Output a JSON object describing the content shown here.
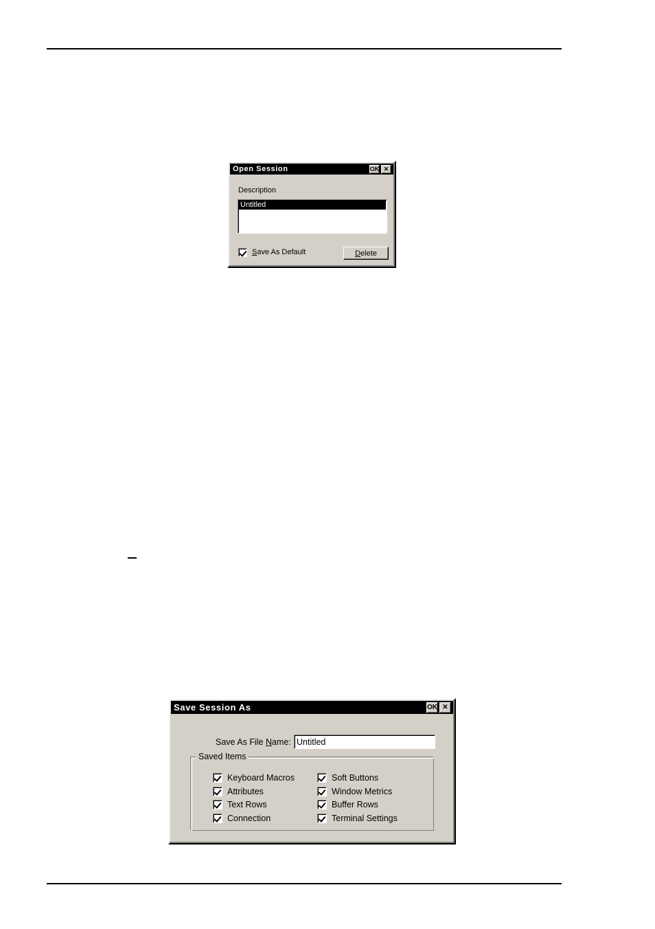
{
  "page": {
    "background": "#ffffff",
    "rule_color": "#000000",
    "stray_dash": "—"
  },
  "dialog_open_session": {
    "title": "Open Session",
    "titlebar_buttons": [
      {
        "name": "ok-titlebar-button",
        "label": "OK"
      },
      {
        "name": "close-titlebar-button",
        "label": "✕"
      }
    ],
    "description_label": "Description",
    "list_items": [
      {
        "label": "Untitled",
        "selected": true
      }
    ],
    "save_as_default": {
      "label": "Save As Default",
      "accel": "S",
      "checked": true
    },
    "delete_button": {
      "label": "Delete",
      "accel": "D"
    },
    "colors": {
      "face": "#d4d0c8",
      "titlebar": "#000000",
      "titlebar_text": "#ffffff",
      "selection": "#000000"
    }
  },
  "dialog_save_session_as": {
    "title": "Save Session As",
    "titlebar_buttons": [
      {
        "name": "ok-titlebar-button",
        "label": "OK"
      },
      {
        "name": "close-titlebar-button",
        "label": "✕"
      }
    ],
    "file_name_field": {
      "label": "Save As File Name:",
      "accel": "N",
      "value": "Untitled",
      "placeholder": ""
    },
    "saved_items": {
      "group_title": "Saved Items",
      "column_left": [
        {
          "label": "Keyboard Macros",
          "checked": true
        },
        {
          "label": "Attributes",
          "checked": true
        },
        {
          "label": "Text Rows",
          "checked": true
        },
        {
          "label": "Connection",
          "checked": true
        }
      ],
      "column_right": [
        {
          "label": "Soft Buttons",
          "checked": true
        },
        {
          "label": "Window Metrics",
          "checked": true
        },
        {
          "label": "Buffer Rows",
          "checked": true
        },
        {
          "label": "Terminal Settings",
          "checked": true
        }
      ]
    },
    "colors": {
      "face": "#d4d0c8",
      "titlebar": "#000000",
      "titlebar_text": "#ffffff"
    }
  }
}
